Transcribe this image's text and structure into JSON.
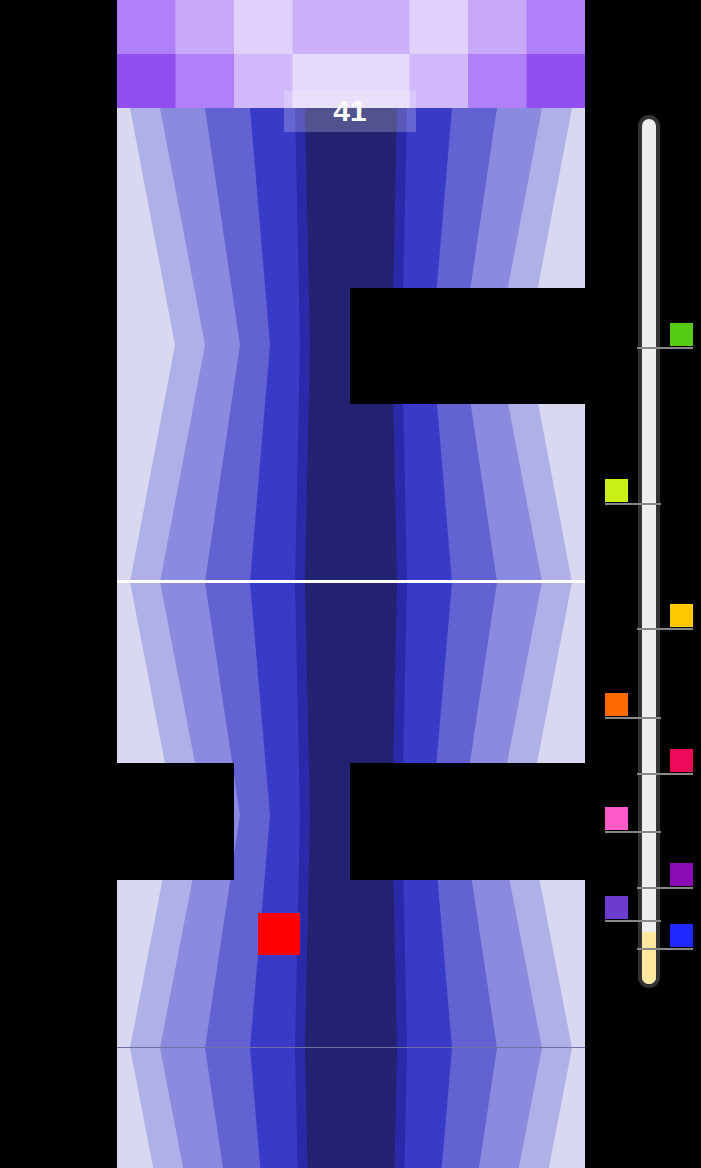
{
  "score": "41",
  "progress": {
    "level": 0.06,
    "markers": [
      {
        "color": "#55cc11"
      },
      {
        "color": "#c8f016"
      },
      {
        "color": "#ffc800"
      },
      {
        "color": "#ff6a00"
      },
      {
        "color": "#ee0a5a"
      },
      {
        "color": "#ff5ac8"
      },
      {
        "color": "#8c0ab4"
      },
      {
        "color": "#6e3ccd"
      },
      {
        "color": "#1e28ff"
      }
    ]
  }
}
